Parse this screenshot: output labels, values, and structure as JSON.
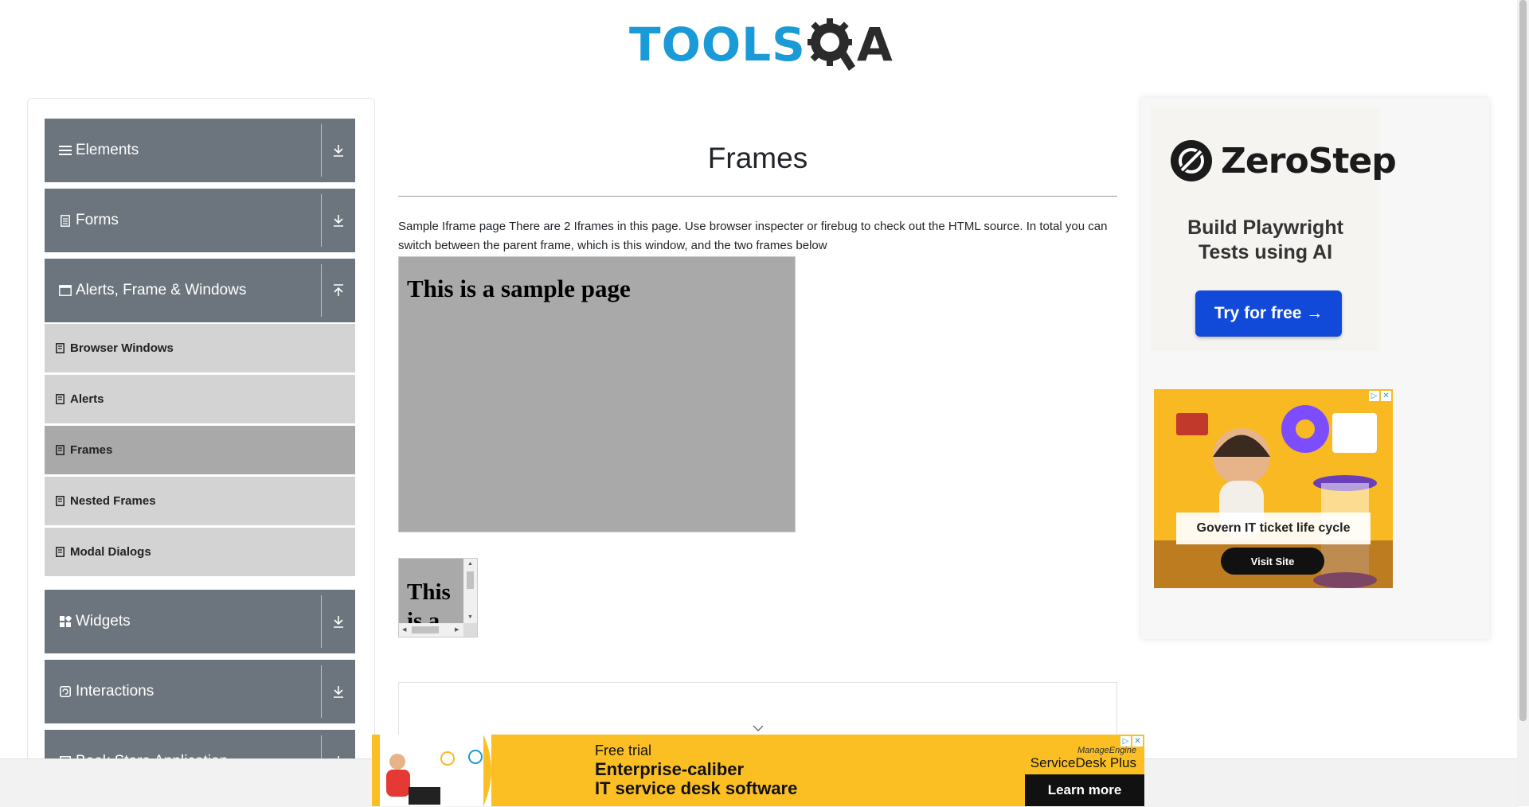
{
  "header": {
    "logo_tools": "TOOLS",
    "logo_q": "Q",
    "logo_a": "A"
  },
  "sidebar": {
    "groups": [
      {
        "label": "Elements",
        "icon": "menu-icon",
        "state": "collapsed"
      },
      {
        "label": "Forms",
        "icon": "document-icon",
        "state": "collapsed"
      },
      {
        "label": "Alerts, Frame & Windows",
        "icon": "window-icon",
        "state": "expanded"
      },
      {
        "label": "Widgets",
        "icon": "widgets-icon",
        "state": "collapsed"
      },
      {
        "label": "Interactions",
        "icon": "interactions-icon",
        "state": "collapsed"
      },
      {
        "label": "Book Store Application",
        "icon": "book-icon",
        "state": "collapsed"
      }
    ],
    "alerts_items": [
      {
        "label": "Browser Windows",
        "active": false
      },
      {
        "label": "Alerts",
        "active": false
      },
      {
        "label": "Frames",
        "active": true
      },
      {
        "label": "Nested Frames",
        "active": false
      },
      {
        "label": "Modal Dialogs",
        "active": false
      }
    ]
  },
  "main": {
    "title": "Frames",
    "description": "Sample Iframe page There are 2 Iframes in this page. Use browser inspecter or firebug to check out the HTML source. In total you can switch between the parent frame, which is this window, and the two frames below",
    "frame1_heading": "This is a sample page",
    "frame2_heading": "This is a"
  },
  "ads": {
    "zerostep": {
      "brand": "ZeroStep",
      "tagline_line1": "Build Playwright",
      "tagline_line2": "Tests using AI",
      "button": "Try for free →"
    },
    "servicedesk_square": {
      "caption": "Govern IT ticket life cycle",
      "button": "Visit Site"
    },
    "bottom_banner": {
      "free_trial": "Free trial",
      "headline_line1": "Enterprise-caliber",
      "headline_line2": "IT service desk software",
      "brand_small": "ManageEngine",
      "brand": "ServiceDesk Plus",
      "button": "Learn more"
    }
  },
  "colors": {
    "sidebar_header_bg": "#6c757d",
    "sidebar_item_bg": "#d3d3d3",
    "sidebar_item_active_bg": "#a9a9a9",
    "logo_blue": "#1a9ad6",
    "zerostep_button": "#1149d8",
    "ad_yellow": "#fbbf24"
  }
}
